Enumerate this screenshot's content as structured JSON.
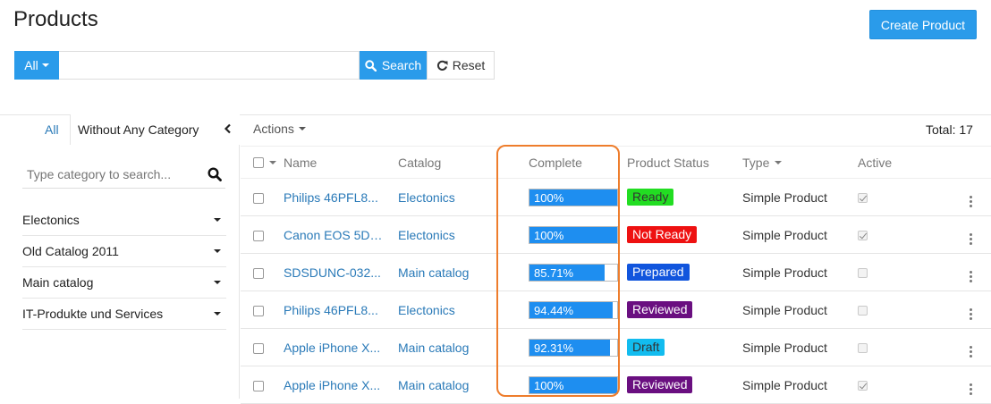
{
  "header": {
    "title": "Products",
    "create_label": "Create Product"
  },
  "search": {
    "filter_label": "All",
    "placeholder": "",
    "value": "",
    "search_label": "Search",
    "reset_label": "Reset"
  },
  "sidebar": {
    "tab_all": "All",
    "tab_without": "Without Any Category",
    "search_placeholder": "Type category to search...",
    "categories": [
      "Electonics",
      "Old Catalog 2011",
      "Main catalog",
      "IT-Produkte und Services"
    ]
  },
  "list": {
    "actions_label": "Actions",
    "total_label": "Total: 17",
    "columns": {
      "name": "Name",
      "catalog": "Catalog",
      "complete": "Complete",
      "status": "Product Status",
      "type": "Type",
      "active": "Active"
    },
    "rows": [
      {
        "name": "Philips 46PFL8...",
        "catalog": "Electonics",
        "complete": 100,
        "complete_label": "100%",
        "status": "Ready",
        "status_color": "#22dd22",
        "status_text_color": "#333333",
        "type": "Simple Product",
        "active": true
      },
      {
        "name": "Canon EOS 5D ...",
        "catalog": "Electonics",
        "complete": 100,
        "complete_label": "100%",
        "status": "Not Ready",
        "status_color": "#ee1111",
        "status_text_color": "#ffffff",
        "type": "Simple Product",
        "active": true
      },
      {
        "name": "SDSDUNC-032...",
        "catalog": "Main catalog",
        "complete": 85.71,
        "complete_label": "85.71%",
        "status": "Prepared",
        "status_color": "#1155dd",
        "status_text_color": "#ffffff",
        "type": "Simple Product",
        "active": false
      },
      {
        "name": "Philips 46PFL8...",
        "catalog": "Electonics",
        "complete": 94.44,
        "complete_label": "94.44%",
        "status": "Reviewed",
        "status_color": "#6a0f80",
        "status_text_color": "#ffffff",
        "type": "Simple Product",
        "active": false
      },
      {
        "name": "Apple iPhone X...",
        "catalog": "Main catalog",
        "complete": 92.31,
        "complete_label": "92.31%",
        "status": "Draft",
        "status_color": "#12bcef",
        "status_text_color": "#333333",
        "type": "Simple Product",
        "active": false
      },
      {
        "name": "Apple iPhone X...",
        "catalog": "Main catalog",
        "complete": 100,
        "complete_label": "100%",
        "status": "Reviewed",
        "status_color": "#6a0f80",
        "status_text_color": "#ffffff",
        "type": "Simple Product",
        "active": true
      }
    ]
  },
  "colors": {
    "accent": "#2a9bea",
    "link": "#2a7ab8",
    "progress": "#1e8ef0",
    "highlight": "#ee7d2c"
  }
}
